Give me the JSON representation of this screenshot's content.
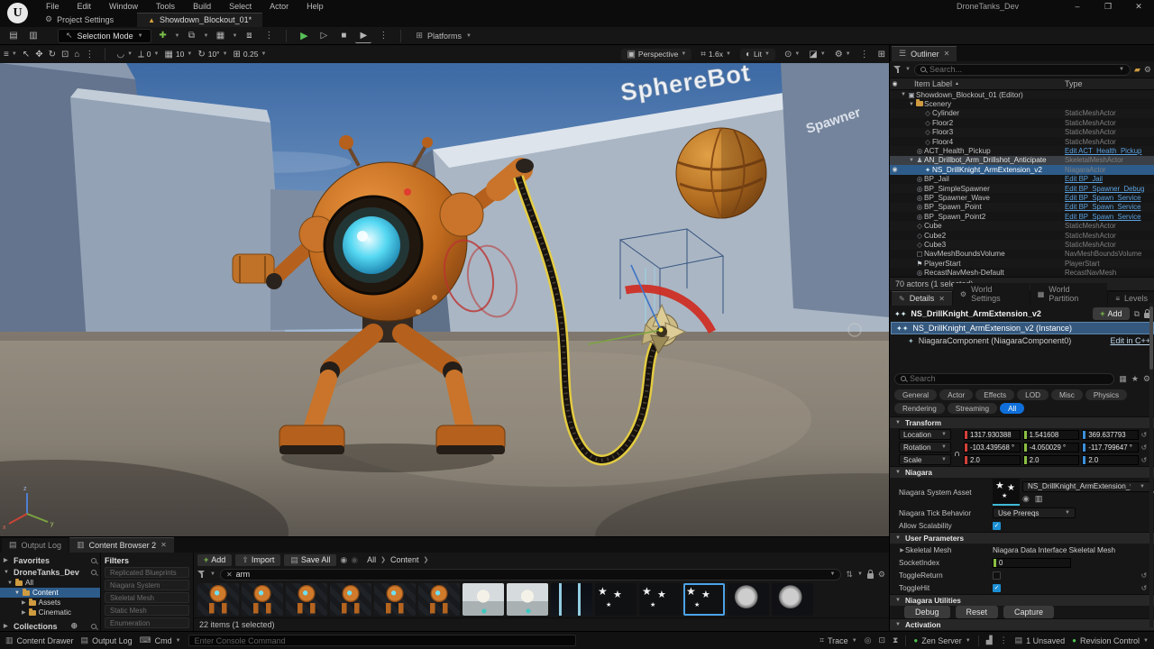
{
  "window": {
    "logo": "U",
    "title": "DroneTanks_Dev",
    "menus": [
      "File",
      "Edit",
      "Window",
      "Tools",
      "Build",
      "Select",
      "Actor",
      "Help"
    ],
    "controls": {
      "minimize": "–",
      "maximize": "❐",
      "close": "✕"
    }
  },
  "tabrow": {
    "project_settings": "Project Settings",
    "level_tab": "Showdown_Blockout_01*"
  },
  "toolbar": {
    "selection_mode": "Selection Mode",
    "platforms": "Platforms"
  },
  "viewport": {
    "snap": {
      "surface": "0",
      "grid": "10",
      "rotation": "10°",
      "scale": "0.25"
    },
    "camera": {
      "projection": "Perspective",
      "speed": "1.6x",
      "view_mode": "Lit"
    },
    "scene_labels": {
      "spherebot": "SphereBot",
      "spawner": "Spawner"
    },
    "axis": {
      "x": "x",
      "y": "y",
      "z": "z"
    }
  },
  "outliner": {
    "tab": "Outliner",
    "search_placeholder": "Search...",
    "columns": {
      "label": "Item Label",
      "type": "Type"
    },
    "rows": [
      {
        "label": "Showdown_Blockout_01 (Editor)",
        "type": "",
        "icon": "level",
        "indent": 0,
        "exp": "open"
      },
      {
        "label": "Scenery",
        "type": "",
        "icon": "folder",
        "indent": 1,
        "exp": "open"
      },
      {
        "label": "Cylinder",
        "type": "StaticMeshActor",
        "icon": "mesh",
        "indent": 2
      },
      {
        "label": "Floor2",
        "type": "StaticMeshActor",
        "icon": "mesh",
        "indent": 2
      },
      {
        "label": "Floor3",
        "type": "StaticMeshActor",
        "icon": "mesh",
        "indent": 2
      },
      {
        "label": "Floor4",
        "type": "StaticMeshActor",
        "icon": "mesh",
        "indent": 2
      },
      {
        "label": "ACT_Health_Pickup",
        "type": "Edit ACT_Health_Pickup",
        "icon": "bp",
        "indent": 1,
        "link": true
      },
      {
        "label": "AN_Drillbot_Arm_Drillshot_Anticipate",
        "type": "SkeletalMeshActor",
        "icon": "skel",
        "indent": 1,
        "exp": "open",
        "state": "hovered"
      },
      {
        "label": "NS_DrillKnight_ArmExtension_v2",
        "type": "NiagaraActor",
        "icon": "niagara",
        "indent": 2,
        "state": "selected",
        "eye": true
      },
      {
        "label": "BP_Jail",
        "type": "Edit BP_Jail",
        "icon": "bp",
        "indent": 1,
        "link": true
      },
      {
        "label": "BP_SimpleSpawner",
        "type": "Edit BP_Spawner_Debug",
        "icon": "bp",
        "indent": 1,
        "link": true
      },
      {
        "label": "BP_Spawner_Wave",
        "type": "Edit BP_Spawn_Service",
        "icon": "bp",
        "indent": 1,
        "link": true
      },
      {
        "label": "BP_Spawn_Point",
        "type": "Edit BP_Spawn_Service",
        "icon": "bp",
        "indent": 1,
        "link": true
      },
      {
        "label": "BP_Spawn_Point2",
        "type": "Edit BP_Spawn_Service",
        "icon": "bp",
        "indent": 1,
        "link": true
      },
      {
        "label": "Cube",
        "type": "StaticMeshActor",
        "icon": "mesh",
        "indent": 1
      },
      {
        "label": "Cube2",
        "type": "StaticMeshActor",
        "icon": "mesh",
        "indent": 1
      },
      {
        "label": "Cube3",
        "type": "StaticMeshActor",
        "icon": "mesh",
        "indent": 1
      },
      {
        "label": "NavMeshBoundsVolume",
        "type": "NavMeshBoundsVolume",
        "icon": "volume",
        "indent": 1
      },
      {
        "label": "PlayerStart",
        "type": "PlayerStart",
        "icon": "player",
        "indent": 1
      },
      {
        "label": "RecastNavMesh-Default",
        "type": "RecastNavMesh",
        "icon": "nav",
        "indent": 1
      }
    ],
    "footer": "70 actors (1 selected)"
  },
  "details": {
    "tabs": [
      "Details",
      "World Settings",
      "World Partition",
      "Levels"
    ],
    "selected_actor": "NS_DrillKnight_ArmExtension_v2",
    "add_button": "Add",
    "instance_row": "NS_DrillKnight_ArmExtension_v2 (Instance)",
    "component_row": "NiagaraComponent (NiagaraComponent0)",
    "edit_in_cpp": "Edit in C++",
    "search_placeholder": "Search",
    "categories": [
      "General",
      "Actor",
      "Effects",
      "LOD",
      "Misc",
      "Physics",
      "Rendering",
      "Streaming",
      "All"
    ],
    "selected_category": "All",
    "sections": {
      "transform": "Transform",
      "niagara": "Niagara",
      "user_parameters": "User Parameters",
      "niagara_utilities": "Niagara Utilities",
      "activation": "Activation"
    },
    "transform": {
      "rows": [
        {
          "label": "Location",
          "x": "1317.930388",
          "y": "1.541608",
          "z": "369.637793",
          "lock": false
        },
        {
          "label": "Rotation",
          "x": "-103.439568 °",
          "y": "-4.050029 °",
          "z": "-117.799647 °",
          "lock": false
        },
        {
          "label": "Scale",
          "x": "2.0",
          "y": "2.0",
          "z": "2.0",
          "lock": true
        }
      ]
    },
    "niagara": {
      "system_asset_label": "Niagara System Asset",
      "system_asset_value": "NS_DrillKnight_ArmExtension_v2",
      "tick_label": "Niagara Tick Behavior",
      "tick_value": "Use Prereqs",
      "scalability_label": "Allow Scalability"
    },
    "user_parameters": {
      "skeletal_mesh_label": "Skeletal Mesh",
      "skeletal_mesh_value": "Niagara Data Interface Skeletal Mesh",
      "socket_index_label": "SocketIndex",
      "socket_index_value": "0",
      "toggle_return_label": "ToggleReturn",
      "toggle_hit_label": "ToggleHit"
    },
    "utilities_buttons": [
      "Debug",
      "Reset",
      "Capture"
    ]
  },
  "content_browser": {
    "tabs": {
      "output_log": "Output Log",
      "content_browser": "Content Browser 2"
    },
    "favorites": "Favorites",
    "project": "DroneTanks_Dev",
    "collections": "Collections",
    "tree": {
      "all": "All",
      "content": "Content",
      "assets": "Assets",
      "cinematic": "Cinematic"
    },
    "filters_title": "Filters",
    "filters": [
      "Replicated Blueprints",
      "Niagara System",
      "Skeletal Mesh",
      "Static Mesh",
      "Enumeration"
    ],
    "add": "Add",
    "import": "Import",
    "save_all": "Save All",
    "breadcrumb": [
      "All",
      "Content"
    ],
    "search_value": "arm",
    "items_status": "22 items (1 selected)",
    "thumbnails": [
      {
        "type": "robot"
      },
      {
        "type": "robot"
      },
      {
        "type": "robot"
      },
      {
        "type": "robot"
      },
      {
        "type": "robot"
      },
      {
        "type": "robot"
      },
      {
        "type": "photo"
      },
      {
        "type": "photo"
      },
      {
        "type": "beam"
      },
      {
        "type": "stars"
      },
      {
        "type": "stars"
      },
      {
        "type": "stars",
        "selected": true
      },
      {
        "type": "sphere"
      },
      {
        "type": "sphere"
      }
    ]
  },
  "status_bar": {
    "content_drawer": "Content Drawer",
    "output_log": "Output Log",
    "cmd": "Cmd",
    "console_placeholder": "Enter Console Command",
    "trace": "Trace",
    "zen": "Zen Server",
    "unsaved": "1 Unsaved",
    "revision": "Revision Control"
  },
  "colors": {
    "accent": "#0f6fda",
    "selection": "#2e5c8a",
    "link": "#5ba2e0",
    "folder": "#cf9b40",
    "play_green": "#58c058",
    "niagara_cyan": "#3fb9d8"
  }
}
